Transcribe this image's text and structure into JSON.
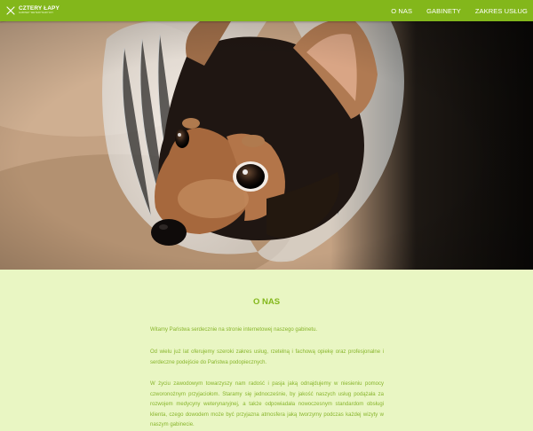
{
  "header": {
    "logo_name": "CZTERY ŁAPY",
    "logo_subtitle": "GABINET WETERYNARYJNY",
    "brand_color": "#83b71b",
    "nav": [
      {
        "label": "O NAS"
      },
      {
        "label": "GABINETY"
      },
      {
        "label": "ZAKRES USŁUG"
      }
    ]
  },
  "hero": {
    "image": "dog-with-cone-photo"
  },
  "about": {
    "title": "O NAS",
    "paragraphs": [
      "Witamy Państwa serdecznie na stronie internetowej naszego gabinetu.",
      "Od wielu już lat oferujemy szeroki zakres usług, rzetelną i fachową opiekę oraz profesjonalne i serdeczne podejście do Państwa podopiecznych.",
      "W życiu zawodowym towarzyszy nam radość i pasja jaką odnajdujemy w niesieniu pomocy czworonożnym przyjaciołom. Staramy się jednocześnie, by jakość naszych usług podążała za rozwojem medycyny weterynaryjnej, a także odpowiadała nowoczesnym standardom obsługi klienta, czego dowodem może być przyjazna atmosfera jaką tworzymy podczas każdej wizyty w naszym gabinecie."
    ]
  },
  "colors": {
    "page_background": "#e9f6c3",
    "text_green": "#88b52c"
  }
}
